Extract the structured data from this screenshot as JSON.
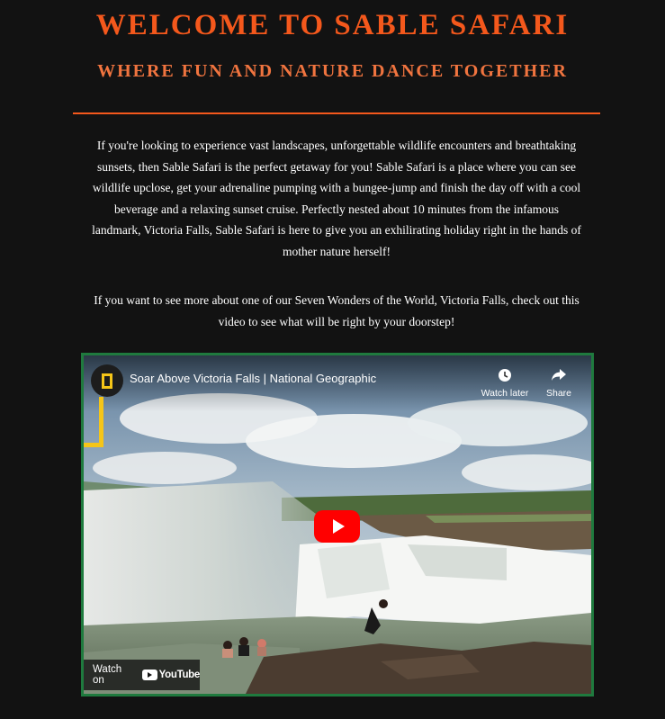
{
  "header": {
    "title": "WELCOME TO SABLE SAFARI",
    "subtitle": "WHERE FUN AND NATURE DANCE TOGETHER"
  },
  "intro": {
    "paragraph1": "If you're looking to experience vast landscapes, unforgettable wildlife encounters and breathtaking sunsets, then Sable Safari is the perfect getaway for you! Sable Safari is a place where you can see wildlife upclose, get your adrenaline pumping with a bungee-jump and finish the day off with a cool beverage and a relaxing sunset cruise. Perfectly nested about 10 minutes from the infamous landmark, Victoria Falls, Sable Safari is here to give you an exhilirating holiday right in the hands of mother nature herself!",
    "paragraph2": "If you want to see more about one of our Seven Wonders of the World, Victoria Falls, check out this video to see what will be right by your doorstep!"
  },
  "video": {
    "title": "Soar Above Victoria Falls | National Geographic",
    "watch_later_label": "Watch later",
    "share_label": "Share",
    "watch_on_label": "Watch on",
    "youtube_label": "YouTube",
    "icons": [
      "national-geographic-logo-icon",
      "clock-icon",
      "share-icon",
      "play-icon",
      "youtube-logo-icon"
    ]
  },
  "colors": {
    "background": "#121212",
    "title": "#f4581c",
    "subtitle": "#f0743f",
    "divider": "#f4581c",
    "video_border": "#1f7a3e",
    "play_button": "#ff0000",
    "natgeo_yellow": "#f5c518"
  }
}
